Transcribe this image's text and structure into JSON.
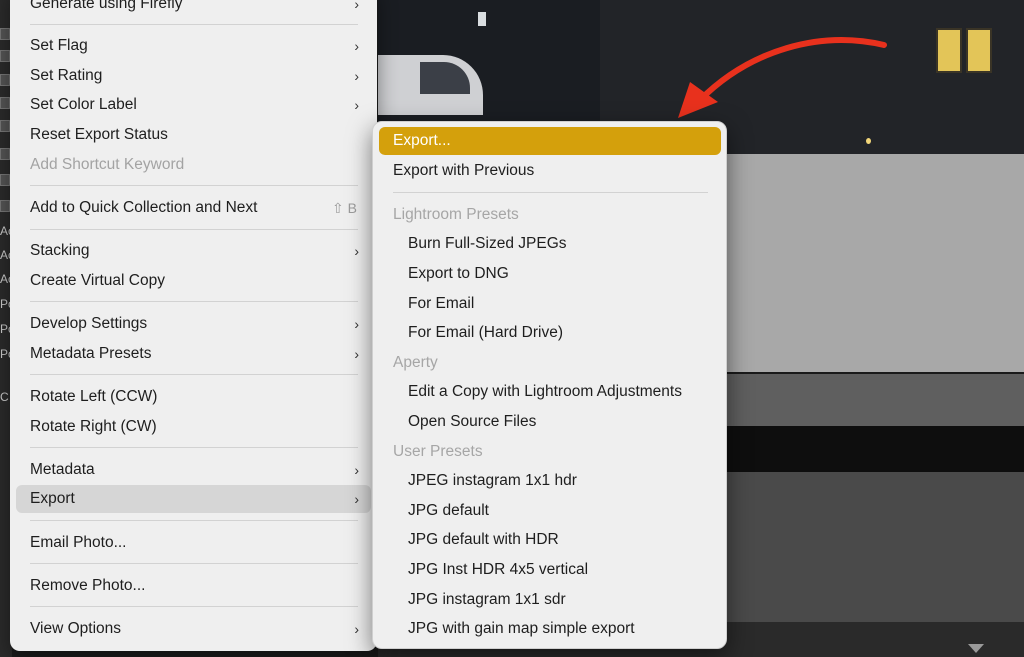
{
  "main_menu": {
    "items": [
      {
        "label": "Generate using Firefly",
        "submenu": true
      },
      {
        "label": "Set Flag",
        "submenu": true
      },
      {
        "label": "Set Rating",
        "submenu": true
      },
      {
        "label": "Set Color Label",
        "submenu": true
      },
      {
        "label": "Reset Export Status",
        "submenu": false
      },
      {
        "label": "Add Shortcut Keyword",
        "submenu": false,
        "disabled": true
      },
      {
        "label": "Add to Quick Collection and Next",
        "shortcut": "⇧ B"
      },
      {
        "label": "Stacking",
        "submenu": true
      },
      {
        "label": "Create Virtual Copy"
      },
      {
        "label": "Develop Settings",
        "submenu": true
      },
      {
        "label": "Metadata Presets",
        "submenu": true
      },
      {
        "label": "Rotate Left (CCW)"
      },
      {
        "label": "Rotate Right (CW)"
      },
      {
        "label": "Metadata",
        "submenu": true
      },
      {
        "label": "Export",
        "submenu": true,
        "state": "hover"
      },
      {
        "label": "Email Photo..."
      },
      {
        "label": "Remove Photo..."
      },
      {
        "label": "View Options",
        "submenu": true
      }
    ],
    "chevron": "›"
  },
  "export_submenu": {
    "export_label": "Export...",
    "export_with_previous_label": "Export with Previous",
    "sections": [
      {
        "title": "Lightroom Presets",
        "items": [
          "Burn Full-Sized JPEGs",
          "Export to DNG",
          "For Email",
          "For Email (Hard Drive)"
        ]
      },
      {
        "title": "Aperty",
        "items": [
          "Edit a Copy with Lightroom Adjustments",
          "Open Source Files"
        ]
      },
      {
        "title": "User Presets",
        "items": [
          "JPEG instagram 1x1 hdr",
          "JPG default",
          "JPG default with HDR",
          "JPG Inst HDR 4x5 vertical",
          "JPG instagram 1x1 sdr",
          "JPG with gain map simple export"
        ]
      }
    ]
  },
  "left_strip_text": [
    "Ac",
    "Ac",
    "Ac",
    "Po",
    "Po",
    "Po",
    "C"
  ],
  "colors": {
    "highlight": "#d4a00c",
    "arrow": "#e8311d",
    "menu_bg": "#efefef"
  },
  "icons": {
    "arrow": "red-curved-arrow-icon",
    "chevron": "chevron-right-icon"
  }
}
